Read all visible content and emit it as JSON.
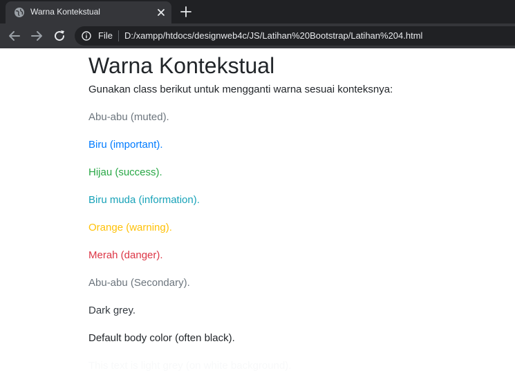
{
  "browser": {
    "tab_title": "Warna Kontekstual",
    "scheme": "File",
    "url": "D:/xampp/htdocs/designweb4c/JS/Latihan%20Bootstrap/Latihan%204.html"
  },
  "page": {
    "title": "Warna Kontekstual",
    "intro": "Gunakan class berikut untuk mengganti warna sesuai konteksnya:",
    "lines": [
      {
        "text": "Abu-abu (muted).",
        "color": "#6c757d"
      },
      {
        "text": "Biru (important).",
        "color": "#007bff"
      },
      {
        "text": "Hijau (success).",
        "color": "#28a745"
      },
      {
        "text": "Biru muda (information).",
        "color": "#17a2b8"
      },
      {
        "text": "Orange (warning).",
        "color": "#ffc107"
      },
      {
        "text": "Merah (danger).",
        "color": "#dc3545"
      },
      {
        "text": "Abu-abu (Secondary).",
        "color": "#6c757d"
      },
      {
        "text": "Dark grey.",
        "color": "#343a40"
      },
      {
        "text": "Default body color (often black).",
        "color": "#212529"
      },
      {
        "text": "This text is light grey (on white background).",
        "color": "#f8f9fa"
      }
    ]
  },
  "icons": {
    "favicon": "globe-icon",
    "close": "close-icon",
    "new_tab": "plus-icon",
    "back": "arrow-left-icon",
    "forward": "arrow-right-icon",
    "reload": "reload-icon",
    "info": "info-icon"
  }
}
